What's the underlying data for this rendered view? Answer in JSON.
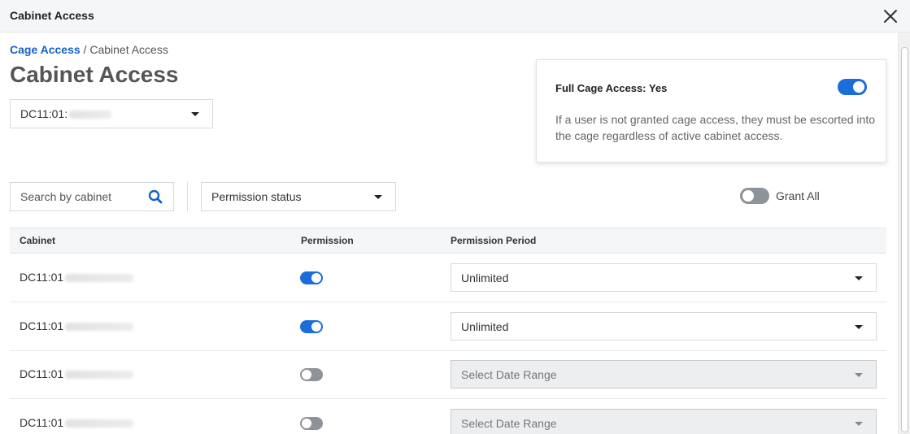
{
  "window": {
    "title": "Cabinet Access"
  },
  "breadcrumb": {
    "parent": "Cage Access",
    "separator": " / ",
    "current": "Cabinet Access"
  },
  "page": {
    "title": "Cabinet Access"
  },
  "cage_select": {
    "value": "DC11:01:"
  },
  "full_cage": {
    "label": "Full Cage Access: Yes",
    "enabled": true,
    "description": "If a user is not granted cage access, they must be escorted into the cage regardless of active cabinet access."
  },
  "search": {
    "placeholder": "Search by cabinet"
  },
  "permission_filter": {
    "value": "Permission status"
  },
  "grant_all": {
    "label": "Grant All",
    "enabled": false
  },
  "table": {
    "columns": {
      "cabinet": "Cabinet",
      "permission": "Permission",
      "period": "Permission Period"
    },
    "rows": [
      {
        "cabinet": "DC11:01",
        "permission": true,
        "period": "Unlimited"
      },
      {
        "cabinet": "DC11:01",
        "permission": true,
        "period": "Unlimited"
      },
      {
        "cabinet": "DC11:01",
        "permission": false,
        "period": "Select Date Range"
      },
      {
        "cabinet": "DC11:01",
        "permission": false,
        "period": "Select Date Range"
      }
    ]
  },
  "colors": {
    "accent": "#1a6ddb",
    "link": "#1560c9",
    "toggle_off": "#8e939a"
  }
}
